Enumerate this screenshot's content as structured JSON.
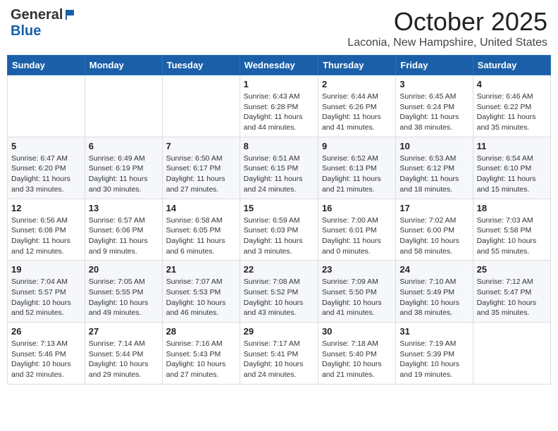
{
  "header": {
    "logo_general": "General",
    "logo_blue": "Blue",
    "month": "October 2025",
    "location": "Laconia, New Hampshire, United States"
  },
  "weekdays": [
    "Sunday",
    "Monday",
    "Tuesday",
    "Wednesday",
    "Thursday",
    "Friday",
    "Saturday"
  ],
  "weeks": [
    [
      {
        "day": "",
        "info": ""
      },
      {
        "day": "",
        "info": ""
      },
      {
        "day": "",
        "info": ""
      },
      {
        "day": "1",
        "info": "Sunrise: 6:43 AM\nSunset: 6:28 PM\nDaylight: 11 hours\nand 44 minutes."
      },
      {
        "day": "2",
        "info": "Sunrise: 6:44 AM\nSunset: 6:26 PM\nDaylight: 11 hours\nand 41 minutes."
      },
      {
        "day": "3",
        "info": "Sunrise: 6:45 AM\nSunset: 6:24 PM\nDaylight: 11 hours\nand 38 minutes."
      },
      {
        "day": "4",
        "info": "Sunrise: 6:46 AM\nSunset: 6:22 PM\nDaylight: 11 hours\nand 35 minutes."
      }
    ],
    [
      {
        "day": "5",
        "info": "Sunrise: 6:47 AM\nSunset: 6:20 PM\nDaylight: 11 hours\nand 33 minutes."
      },
      {
        "day": "6",
        "info": "Sunrise: 6:49 AM\nSunset: 6:19 PM\nDaylight: 11 hours\nand 30 minutes."
      },
      {
        "day": "7",
        "info": "Sunrise: 6:50 AM\nSunset: 6:17 PM\nDaylight: 11 hours\nand 27 minutes."
      },
      {
        "day": "8",
        "info": "Sunrise: 6:51 AM\nSunset: 6:15 PM\nDaylight: 11 hours\nand 24 minutes."
      },
      {
        "day": "9",
        "info": "Sunrise: 6:52 AM\nSunset: 6:13 PM\nDaylight: 11 hours\nand 21 minutes."
      },
      {
        "day": "10",
        "info": "Sunrise: 6:53 AM\nSunset: 6:12 PM\nDaylight: 11 hours\nand 18 minutes."
      },
      {
        "day": "11",
        "info": "Sunrise: 6:54 AM\nSunset: 6:10 PM\nDaylight: 11 hours\nand 15 minutes."
      }
    ],
    [
      {
        "day": "12",
        "info": "Sunrise: 6:56 AM\nSunset: 6:08 PM\nDaylight: 11 hours\nand 12 minutes."
      },
      {
        "day": "13",
        "info": "Sunrise: 6:57 AM\nSunset: 6:06 PM\nDaylight: 11 hours\nand 9 minutes."
      },
      {
        "day": "14",
        "info": "Sunrise: 6:58 AM\nSunset: 6:05 PM\nDaylight: 11 hours\nand 6 minutes."
      },
      {
        "day": "15",
        "info": "Sunrise: 6:59 AM\nSunset: 6:03 PM\nDaylight: 11 hours\nand 3 minutes."
      },
      {
        "day": "16",
        "info": "Sunrise: 7:00 AM\nSunset: 6:01 PM\nDaylight: 11 hours\nand 0 minutes."
      },
      {
        "day": "17",
        "info": "Sunrise: 7:02 AM\nSunset: 6:00 PM\nDaylight: 10 hours\nand 58 minutes."
      },
      {
        "day": "18",
        "info": "Sunrise: 7:03 AM\nSunset: 5:58 PM\nDaylight: 10 hours\nand 55 minutes."
      }
    ],
    [
      {
        "day": "19",
        "info": "Sunrise: 7:04 AM\nSunset: 5:57 PM\nDaylight: 10 hours\nand 52 minutes."
      },
      {
        "day": "20",
        "info": "Sunrise: 7:05 AM\nSunset: 5:55 PM\nDaylight: 10 hours\nand 49 minutes."
      },
      {
        "day": "21",
        "info": "Sunrise: 7:07 AM\nSunset: 5:53 PM\nDaylight: 10 hours\nand 46 minutes."
      },
      {
        "day": "22",
        "info": "Sunrise: 7:08 AM\nSunset: 5:52 PM\nDaylight: 10 hours\nand 43 minutes."
      },
      {
        "day": "23",
        "info": "Sunrise: 7:09 AM\nSunset: 5:50 PM\nDaylight: 10 hours\nand 41 minutes."
      },
      {
        "day": "24",
        "info": "Sunrise: 7:10 AM\nSunset: 5:49 PM\nDaylight: 10 hours\nand 38 minutes."
      },
      {
        "day": "25",
        "info": "Sunrise: 7:12 AM\nSunset: 5:47 PM\nDaylight: 10 hours\nand 35 minutes."
      }
    ],
    [
      {
        "day": "26",
        "info": "Sunrise: 7:13 AM\nSunset: 5:46 PM\nDaylight: 10 hours\nand 32 minutes."
      },
      {
        "day": "27",
        "info": "Sunrise: 7:14 AM\nSunset: 5:44 PM\nDaylight: 10 hours\nand 29 minutes."
      },
      {
        "day": "28",
        "info": "Sunrise: 7:16 AM\nSunset: 5:43 PM\nDaylight: 10 hours\nand 27 minutes."
      },
      {
        "day": "29",
        "info": "Sunrise: 7:17 AM\nSunset: 5:41 PM\nDaylight: 10 hours\nand 24 minutes."
      },
      {
        "day": "30",
        "info": "Sunrise: 7:18 AM\nSunset: 5:40 PM\nDaylight: 10 hours\nand 21 minutes."
      },
      {
        "day": "31",
        "info": "Sunrise: 7:19 AM\nSunset: 5:39 PM\nDaylight: 10 hours\nand 19 minutes."
      },
      {
        "day": "",
        "info": ""
      }
    ]
  ]
}
